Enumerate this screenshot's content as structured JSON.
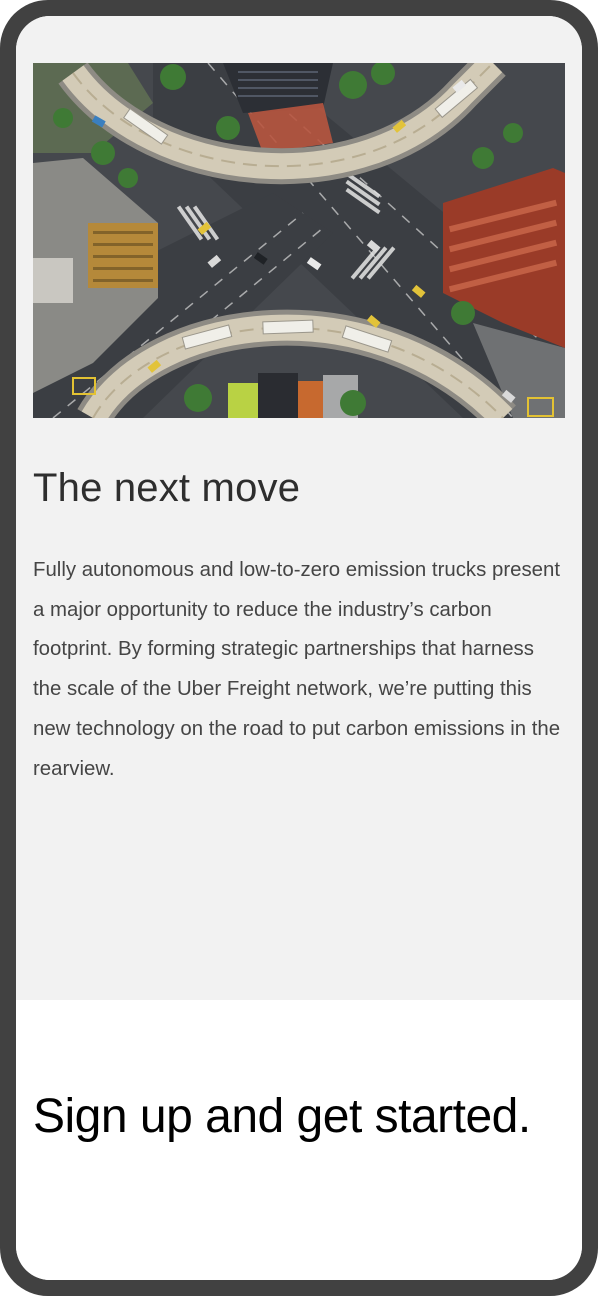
{
  "section": {
    "image_alt": "Aerial view of a city intersection with curved elevated roadways",
    "headline": "The next move",
    "body": "Fully autonomous and low-to-zero emission trucks present a major opportunity to reduce the industry’s carbon footprint. By forming strategic partnerships that harness the scale of the Uber Freight network, we’re putting this new technology on the road to put carbon emissions in the rearview."
  },
  "cta": {
    "heading": "Sign up and get started."
  },
  "colors": {
    "device_frame": "#414141",
    "section_background": "#f2f2f2",
    "headline_text": "#2e2e2e",
    "body_text": "#454545",
    "cta_text": "#000000"
  }
}
